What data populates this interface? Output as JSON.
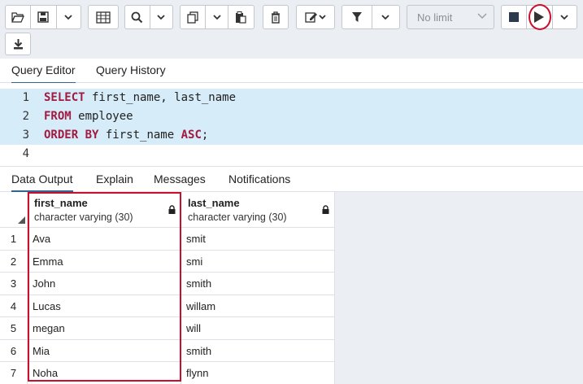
{
  "toolbar": {
    "limit_label": "No limit",
    "icons": [
      "folder-open-icon",
      "save-icon",
      "chevron-down-icon",
      "table-icon",
      "search-icon",
      "copy-icon",
      "paste-icon",
      "delete-icon",
      "edit-icon",
      "filter-icon",
      "stop-icon",
      "play-icon",
      "download-icon"
    ]
  },
  "editor_tabs": [
    "Query Editor",
    "Query History"
  ],
  "editor": {
    "line_numbers": [
      "1",
      "2",
      "3",
      "4"
    ],
    "lines": [
      {
        "kw1": "SELECT",
        "text": " first_name, last_name",
        "kw2": "",
        "tail": ""
      },
      {
        "kw1": "FROM",
        "text": " employee",
        "kw2": "",
        "tail": ""
      },
      {
        "kw1": "ORDER BY",
        "text": " first_name ",
        "kw2": "ASC",
        "tail": ";"
      },
      {
        "kw1": "",
        "text": "",
        "kw2": "",
        "tail": ""
      }
    ]
  },
  "output_tabs": [
    "Data Output",
    "Explain",
    "Messages",
    "Notifications"
  ],
  "grid": {
    "columns": [
      {
        "name": "first_name",
        "type": "character varying (30)"
      },
      {
        "name": "last_name",
        "type": "character varying (30)"
      }
    ],
    "rows": [
      {
        "n": "1",
        "first_name": "Ava",
        "last_name": "smit"
      },
      {
        "n": "2",
        "first_name": "Emma",
        "last_name": "smi"
      },
      {
        "n": "3",
        "first_name": "John",
        "last_name": "smith"
      },
      {
        "n": "4",
        "first_name": "Lucas",
        "last_name": "willam"
      },
      {
        "n": "5",
        "first_name": "megan",
        "last_name": "will"
      },
      {
        "n": "6",
        "first_name": "Mia",
        "last_name": "smith"
      },
      {
        "n": "7",
        "first_name": "Noha",
        "last_name": "flynn"
      }
    ]
  },
  "colors": {
    "accent": "#326690",
    "highlight": "#c8102e",
    "keyword": "#a11a40",
    "line_highlight": "#d6ecf8"
  }
}
